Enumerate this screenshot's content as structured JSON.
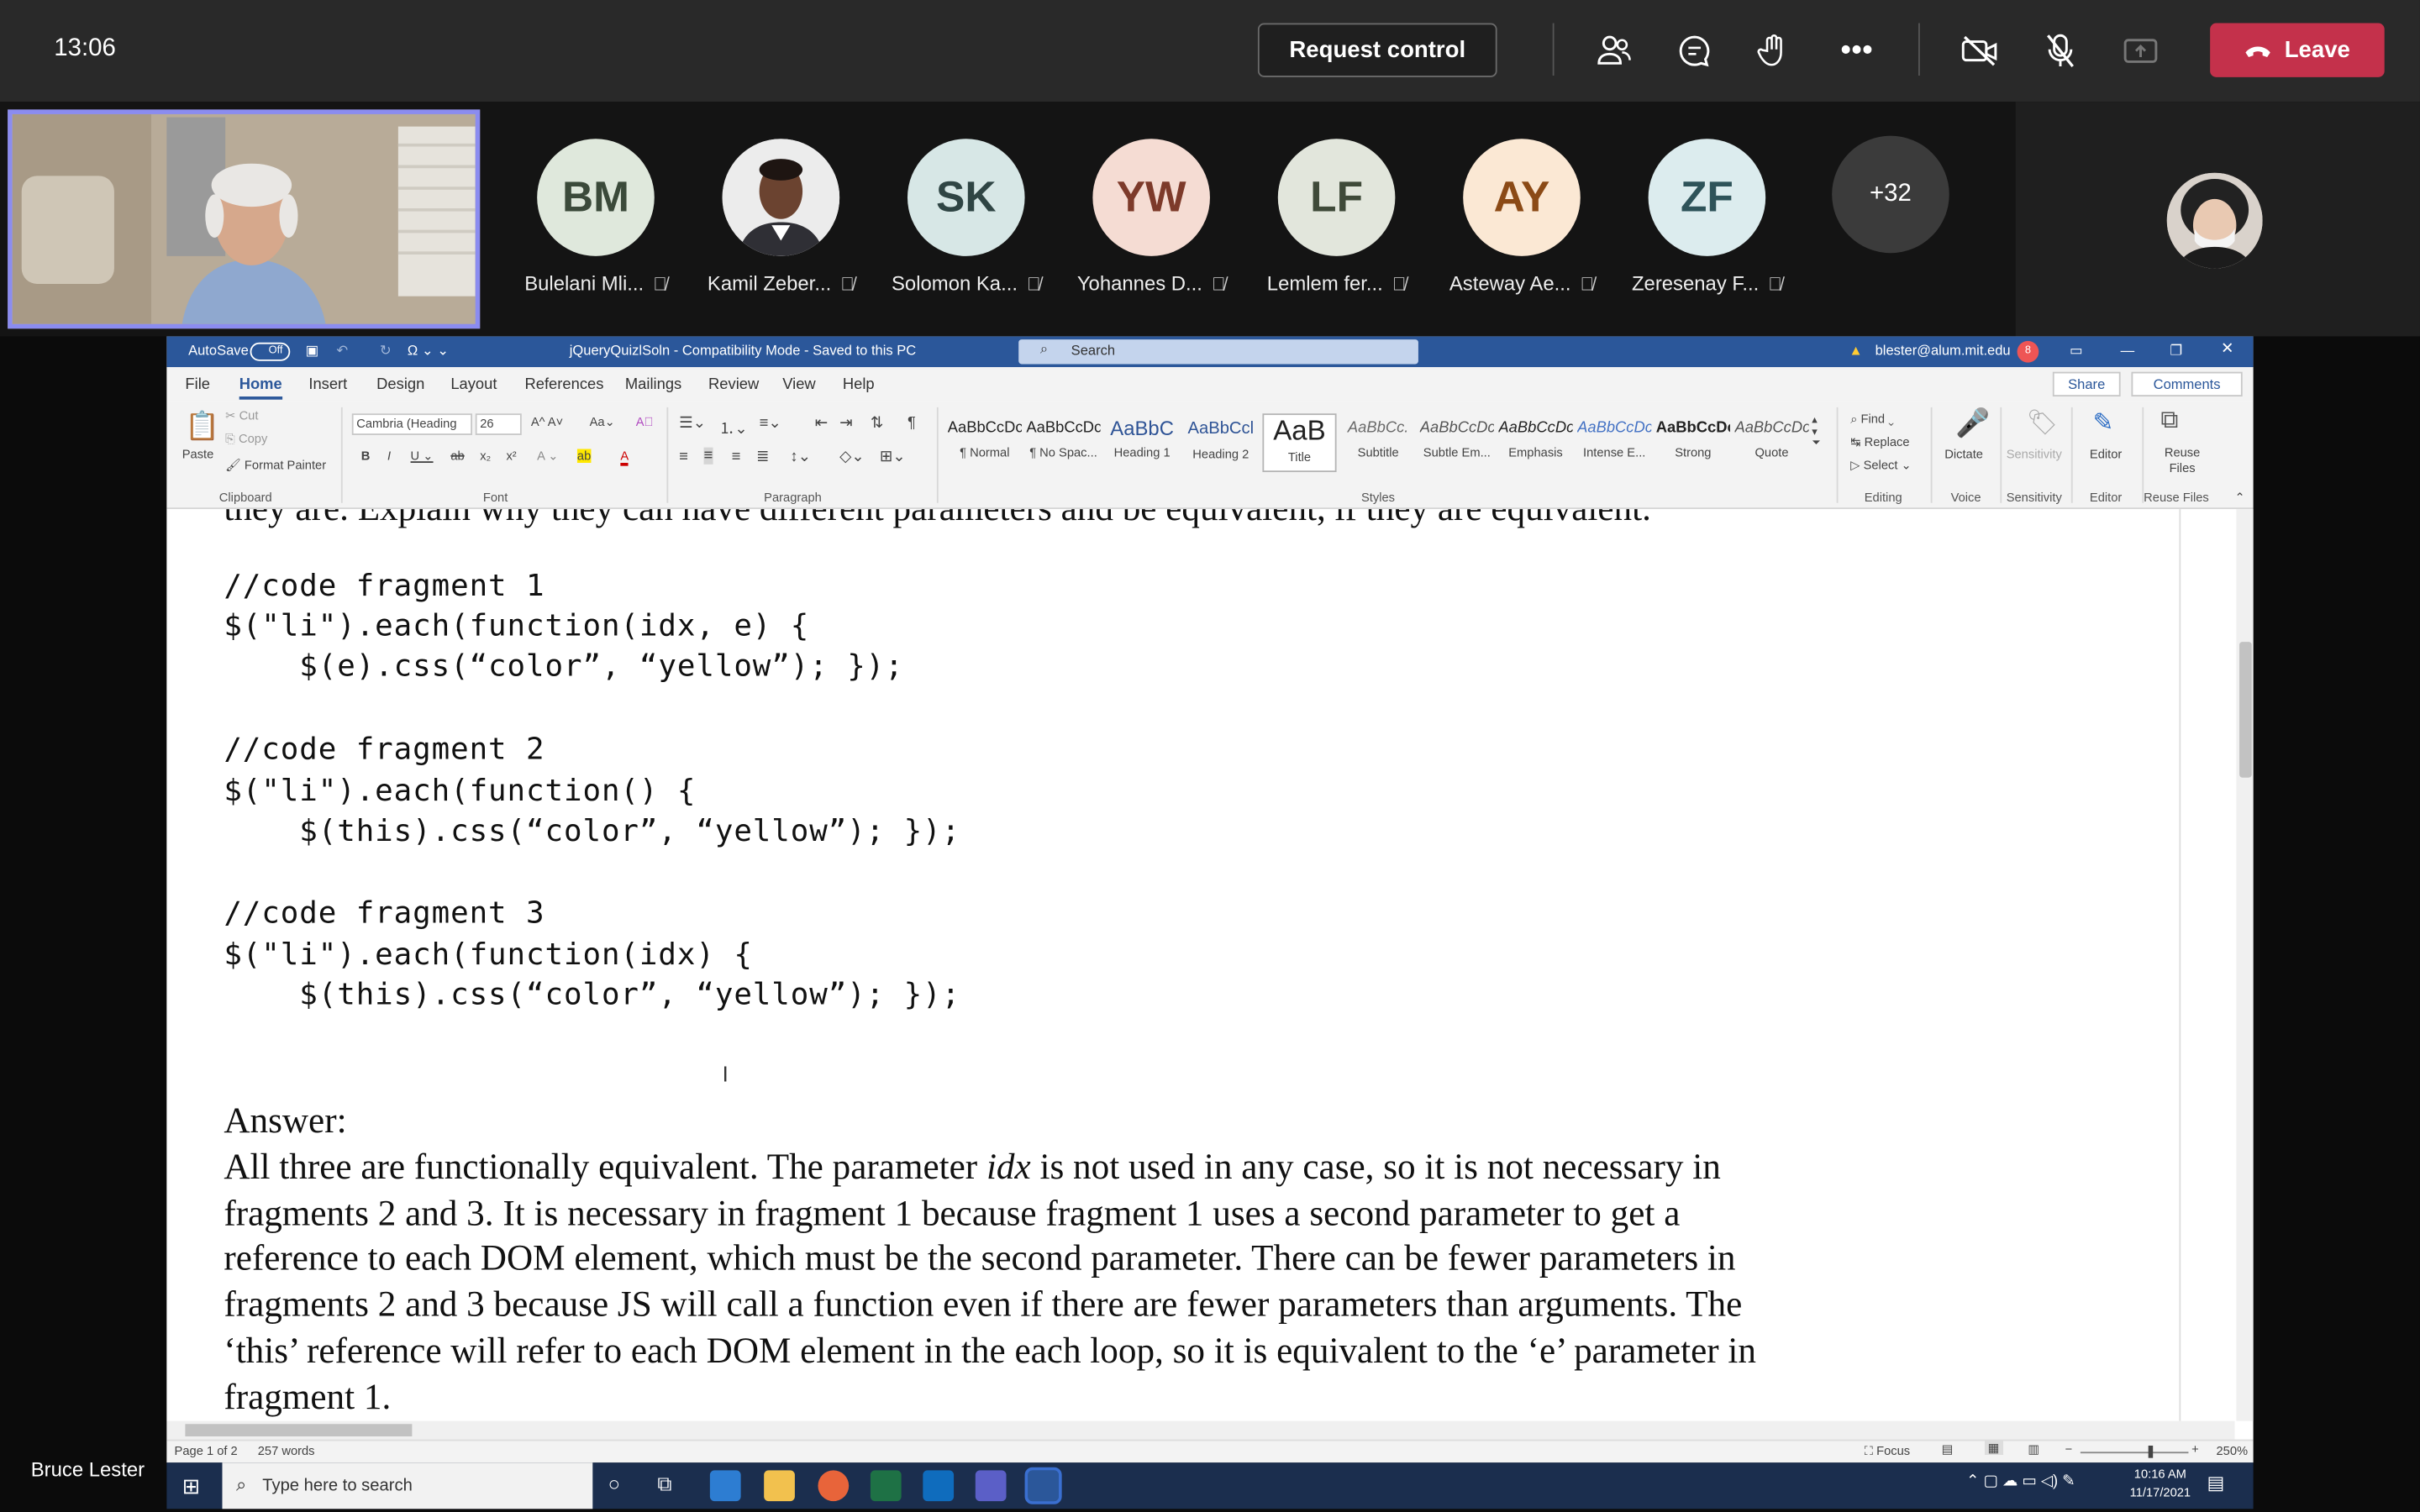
{
  "teams": {
    "clock": "13:06",
    "request_control": "Request control",
    "leave": "Leave",
    "toolbar_icons": [
      "participants-icon",
      "chat-icon",
      "raise-hand-icon",
      "more-icon",
      "camera-off-icon",
      "mic-off-icon",
      "share-tray-icon"
    ],
    "more_label": "•••",
    "participants": [
      {
        "initials": "BM",
        "name": "Bulelani Mli...",
        "bg": "#dfe8dc",
        "fg": "#3b4a3a"
      },
      {
        "initials": "",
        "name": "Kamil Zeber...",
        "bg": "#e9e9e9",
        "fg": "#333"
      },
      {
        "initials": "SK",
        "name": "Solomon Ka...",
        "bg": "#d7e7e6",
        "fg": "#2f4544"
      },
      {
        "initials": "YW",
        "name": "Yohannes D...",
        "bg": "#f5dcd3",
        "fg": "#7d3a2a"
      },
      {
        "initials": "LF",
        "name": "Lemlem fer...",
        "bg": "#e2e6dc",
        "fg": "#3f4a39"
      },
      {
        "initials": "AY",
        "name": "Asteway Ae...",
        "bg": "#fbe8d4",
        "fg": "#8b4a16"
      },
      {
        "initials": "ZF",
        "name": "Zeresenay F...",
        "bg": "#dcecee",
        "fg": "#2e5359"
      }
    ],
    "more_count": "+32",
    "presenter": "Bruce Lester"
  },
  "word": {
    "autosave": "AutoSave",
    "autosave_state": "Off",
    "doc_title": "jQueryQuizlSoln  -  Compatibility Mode  -  Saved to this PC",
    "search_placeholder": "Search",
    "user_email": "blester@alum.mit.edu",
    "notif_count": "8",
    "tabs": [
      "File",
      "Home",
      "Insert",
      "Design",
      "Layout",
      "References",
      "Mailings",
      "Review",
      "View",
      "Help"
    ],
    "share": "Share",
    "comments": "Comments",
    "clipboard": {
      "paste": "Paste",
      "cut": "Cut",
      "copy": "Copy",
      "format_painter": "Format Painter",
      "label": "Clipboard"
    },
    "font": {
      "name": "Cambria (Heading",
      "size": "26",
      "label": "Font"
    },
    "paragraph_label": "Paragraph",
    "styles": [
      {
        "preview": "AaBbCcDc",
        "name": "¶ Normal"
      },
      {
        "preview": "AaBbCcDc",
        "name": "¶ No Spac..."
      },
      {
        "preview": "AaBbC",
        "name": "Heading 1"
      },
      {
        "preview": "AaBbCcl",
        "name": "Heading 2"
      },
      {
        "preview": "AaB",
        "name": "Title"
      },
      {
        "preview": "AaBbCc.",
        "name": "Subtitle"
      },
      {
        "preview": "AaBbCcDc",
        "name": "Subtle Em..."
      },
      {
        "preview": "AaBbCcDc",
        "name": "Emphasis"
      },
      {
        "preview": "AaBbCcDc",
        "name": "Intense E..."
      },
      {
        "preview": "AaBbCcDc",
        "name": "Strong"
      },
      {
        "preview": "AaBbCcDc",
        "name": "Quote"
      }
    ],
    "styles_label": "Styles",
    "editing": {
      "find": "Find",
      "replace": "Replace",
      "select": "Select",
      "label": "Editing"
    },
    "voice": {
      "dictate": "Dictate",
      "label": "Voice"
    },
    "sensitivity": {
      "button": "Sensitivity",
      "label": "Sensitivity"
    },
    "editor": {
      "button": "Editor",
      "label": "Editor"
    },
    "reuse": {
      "button": "Reuse Files",
      "label": "Reuse Files"
    },
    "document": {
      "top_partial": "they are. Explain why they can have different parameters and be equivalent, if they are equivalent.",
      "code_lines": [
        "//code fragment 1",
        "$(\"li\").each(function(idx, e) {",
        "    $(e).css(“color”, “yellow”); });",
        "",
        "//code fragment 2",
        "$(\"li\").each(function() {",
        "    $(this).css(“color”, “yellow”); });",
        "",
        "//code fragment 3",
        "$(\"li\").each(function(idx) {",
        "    $(this).css(“color”, “yellow”); });"
      ],
      "answer_heading": "Answer:",
      "answer_first_a": "All three are functionally equivalent.  The parameter ",
      "answer_first_italic": "idx",
      "answer_first_b": " is not used in any case, so it is not necessary in",
      "answer_lines": [
        "fragments 2 and 3.  It is necessary in fragment 1 because fragment 1 uses a second parameter to get a",
        "reference to each DOM element, which must be the second parameter.  There can be fewer parameters in",
        "fragments 2 and 3 because JS will call a function even if there are fewer parameters than arguments.  The",
        "‘this’ reference will refer to each DOM element in the each loop, so it is equivalent to the ‘e’ parameter in",
        "fragment 1."
      ]
    },
    "status": {
      "page": "Page 1 of 2",
      "words": "257 words",
      "focus": "Focus",
      "zoom": "250%"
    }
  },
  "taskbar": {
    "search_placeholder": "Type here to search",
    "time": "10:16 AM",
    "date": "11/17/2021"
  }
}
